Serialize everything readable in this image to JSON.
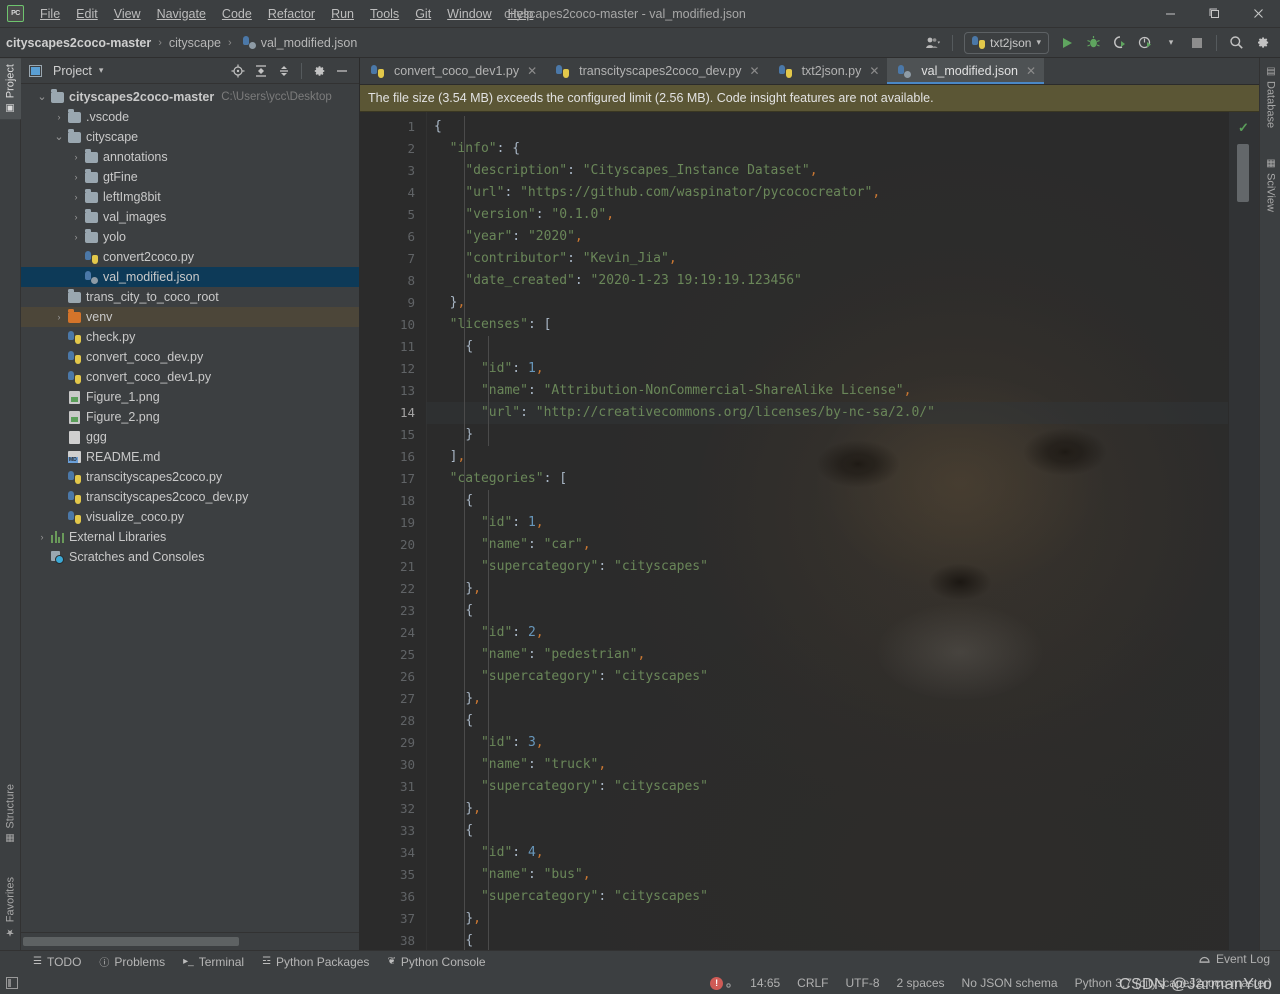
{
  "window": {
    "title": "cityscapes2coco-master - val_modified.json",
    "minimize": "–",
    "maximize": "❐",
    "close": "✕"
  },
  "menubar": {
    "items": [
      "File",
      "Edit",
      "View",
      "Navigate",
      "Code",
      "Refactor",
      "Run",
      "Tools",
      "Git",
      "Window",
      "Help"
    ]
  },
  "breadcrumb": {
    "items": [
      "cityscapes2coco-master",
      "cityscape",
      "val_modified.json"
    ],
    "separator": "›"
  },
  "toolbar": {
    "run_config": "txt2json",
    "dropdown_caret": "▾",
    "run_tooltip": "Run",
    "debug_tooltip": "Debug",
    "coverage_tooltip": "Run with Coverage",
    "profile_tooltip": "Profile",
    "stop_tooltip": "Stop",
    "search_tooltip": "Search Everywhere",
    "settings_tooltip": "Settings"
  },
  "left_stripe": {
    "project": "Project",
    "structure": "Structure",
    "favorites": "Favorites"
  },
  "right_stripe": {
    "database": "Database",
    "sciview": "SciView"
  },
  "project_panel": {
    "title": "Project",
    "title_caret": "▾",
    "icons": [
      "locate-icon",
      "expand-all-icon",
      "collapse-all-icon",
      "settings-icon",
      "hide-icon"
    ],
    "tree": [
      {
        "label": "cityscapes2coco-master",
        "hint": "C:\\Users\\ycc\\Desktop",
        "indent": 0,
        "arrow": "⌄",
        "icon": "folder",
        "bold": true,
        "state": "normal"
      },
      {
        "label": ".vscode",
        "hint": "",
        "indent": 1,
        "arrow": "›",
        "icon": "folder",
        "bold": false,
        "state": "normal"
      },
      {
        "label": "cityscape",
        "hint": "",
        "indent": 1,
        "arrow": "⌄",
        "icon": "folder",
        "bold": false,
        "state": "normal"
      },
      {
        "label": "annotations",
        "hint": "",
        "indent": 2,
        "arrow": "›",
        "icon": "folder",
        "bold": false,
        "state": "normal"
      },
      {
        "label": "gtFine",
        "hint": "",
        "indent": 2,
        "arrow": "›",
        "icon": "folder",
        "bold": false,
        "state": "normal"
      },
      {
        "label": "leftImg8bit",
        "hint": "",
        "indent": 2,
        "arrow": "›",
        "icon": "folder",
        "bold": false,
        "state": "normal"
      },
      {
        "label": "val_images",
        "hint": "",
        "indent": 2,
        "arrow": "›",
        "icon": "folder",
        "bold": false,
        "state": "normal"
      },
      {
        "label": "yolo",
        "hint": "",
        "indent": 2,
        "arrow": "›",
        "icon": "folder",
        "bold": false,
        "state": "normal"
      },
      {
        "label": "convert2coco.py",
        "hint": "",
        "indent": 2,
        "arrow": "",
        "icon": "python",
        "bold": false,
        "state": "normal"
      },
      {
        "label": "val_modified.json",
        "hint": "",
        "indent": 2,
        "arrow": "",
        "icon": "json",
        "bold": false,
        "state": "selected"
      },
      {
        "label": "trans_city_to_coco_root",
        "hint": "",
        "indent": 1,
        "arrow": "",
        "icon": "folder",
        "bold": false,
        "state": "normal"
      },
      {
        "label": "venv",
        "hint": "",
        "indent": 1,
        "arrow": "›",
        "icon": "folder-orange",
        "bold": false,
        "state": "venv"
      },
      {
        "label": "check.py",
        "hint": "",
        "indent": 1,
        "arrow": "",
        "icon": "python",
        "bold": false,
        "state": "normal"
      },
      {
        "label": "convert_coco_dev.py",
        "hint": "",
        "indent": 1,
        "arrow": "",
        "icon": "python",
        "bold": false,
        "state": "normal"
      },
      {
        "label": "convert_coco_dev1.py",
        "hint": "",
        "indent": 1,
        "arrow": "",
        "icon": "python",
        "bold": false,
        "state": "normal"
      },
      {
        "label": "Figure_1.png",
        "hint": "",
        "indent": 1,
        "arrow": "",
        "icon": "png",
        "bold": false,
        "state": "normal"
      },
      {
        "label": "Figure_2.png",
        "hint": "",
        "indent": 1,
        "arrow": "",
        "icon": "png",
        "bold": false,
        "state": "normal"
      },
      {
        "label": "ggg",
        "hint": "",
        "indent": 1,
        "arrow": "",
        "icon": "file",
        "bold": false,
        "state": "normal"
      },
      {
        "label": "README.md",
        "hint": "",
        "indent": 1,
        "arrow": "",
        "icon": "md",
        "bold": false,
        "state": "normal"
      },
      {
        "label": "transcityscapes2coco.py",
        "hint": "",
        "indent": 1,
        "arrow": "",
        "icon": "python",
        "bold": false,
        "state": "normal"
      },
      {
        "label": "transcityscapes2coco_dev.py",
        "hint": "",
        "indent": 1,
        "arrow": "",
        "icon": "python",
        "bold": false,
        "state": "normal"
      },
      {
        "label": "visualize_coco.py",
        "hint": "",
        "indent": 1,
        "arrow": "",
        "icon": "python",
        "bold": false,
        "state": "normal"
      },
      {
        "label": "External Libraries",
        "hint": "",
        "indent": 0,
        "arrow": "›",
        "icon": "lib",
        "bold": false,
        "state": "normal"
      },
      {
        "label": "Scratches and Consoles",
        "hint": "",
        "indent": 0,
        "arrow": "",
        "icon": "scratch",
        "bold": false,
        "state": "normal"
      }
    ]
  },
  "editor": {
    "tabs": [
      {
        "label": "convert_coco_dev1.py",
        "icon": "python",
        "active": false,
        "close": "✕"
      },
      {
        "label": "transcityscapes2coco_dev.py",
        "icon": "python",
        "active": false,
        "close": "✕"
      },
      {
        "label": "txt2json.py",
        "icon": "python",
        "active": false,
        "close": "✕"
      },
      {
        "label": "val_modified.json",
        "icon": "json",
        "active": true,
        "close": "✕"
      }
    ],
    "warning": "The file size (3.54 MB) exceeds the configured limit (2.56 MB). Code insight features are not available.",
    "inspection_status": "✓",
    "current_line": 14,
    "lines": [
      {
        "n": 1,
        "text": "{"
      },
      {
        "n": 2,
        "text": "  \"info\": {"
      },
      {
        "n": 3,
        "text": "    \"description\": \"Cityscapes_Instance Dataset\","
      },
      {
        "n": 4,
        "text": "    \"url\": \"https://github.com/waspinator/pycococreator\","
      },
      {
        "n": 5,
        "text": "    \"version\": \"0.1.0\","
      },
      {
        "n": 6,
        "text": "    \"year\": \"2020\","
      },
      {
        "n": 7,
        "text": "    \"contributor\": \"Kevin_Jia\","
      },
      {
        "n": 8,
        "text": "    \"date_created\": \"2020-1-23 19:19:19.123456\""
      },
      {
        "n": 9,
        "text": "  },"
      },
      {
        "n": 10,
        "text": "  \"licenses\": ["
      },
      {
        "n": 11,
        "text": "    {"
      },
      {
        "n": 12,
        "text": "      \"id\": 1,"
      },
      {
        "n": 13,
        "text": "      \"name\": \"Attribution-NonCommercial-ShareAlike License\","
      },
      {
        "n": 14,
        "text": "      \"url\": \"http://creativecommons.org/licenses/by-nc-sa/2.0/\""
      },
      {
        "n": 15,
        "text": "    }"
      },
      {
        "n": 16,
        "text": "  ],"
      },
      {
        "n": 17,
        "text": "  \"categories\": ["
      },
      {
        "n": 18,
        "text": "    {"
      },
      {
        "n": 19,
        "text": "      \"id\": 1,"
      },
      {
        "n": 20,
        "text": "      \"name\": \"car\","
      },
      {
        "n": 21,
        "text": "      \"supercategory\": \"cityscapes\""
      },
      {
        "n": 22,
        "text": "    },"
      },
      {
        "n": 23,
        "text": "    {"
      },
      {
        "n": 24,
        "text": "      \"id\": 2,"
      },
      {
        "n": 25,
        "text": "      \"name\": \"pedestrian\","
      },
      {
        "n": 26,
        "text": "      \"supercategory\": \"cityscapes\""
      },
      {
        "n": 27,
        "text": "    },"
      },
      {
        "n": 28,
        "text": "    {"
      },
      {
        "n": 29,
        "text": "      \"id\": 3,"
      },
      {
        "n": 30,
        "text": "      \"name\": \"truck\","
      },
      {
        "n": 31,
        "text": "      \"supercategory\": \"cityscapes\""
      },
      {
        "n": 32,
        "text": "    },"
      },
      {
        "n": 33,
        "text": "    {"
      },
      {
        "n": 34,
        "text": "      \"id\": 4,"
      },
      {
        "n": 35,
        "text": "      \"name\": \"bus\","
      },
      {
        "n": 36,
        "text": "      \"supercategory\": \"cityscapes\""
      },
      {
        "n": 37,
        "text": "    },"
      },
      {
        "n": 38,
        "text": "    {"
      }
    ]
  },
  "bottom_tools": [
    {
      "label": "TODO",
      "icon": "todo-icon"
    },
    {
      "label": "Problems",
      "icon": "problems-icon"
    },
    {
      "label": "Terminal",
      "icon": "terminal-icon"
    },
    {
      "label": "Python Packages",
      "icon": "packages-icon"
    },
    {
      "label": "Python Console",
      "icon": "python-console-icon"
    }
  ],
  "statusbar": {
    "event_log": "Event Log",
    "caret_position": "14:65",
    "line_separator": "CRLF",
    "encoding": "UTF-8",
    "indent": "2 spaces",
    "schema": "No JSON schema",
    "interpreter": "Python 3.7 (cityscapes2coco-master)",
    "watermark": "CSDN @JarmanYuo"
  },
  "colors": {
    "accent": "#4a88c7",
    "selection": "#0d3a58",
    "warning_bg": "#5b5635",
    "editor_bg": "#2b2b2b",
    "panel_bg": "#3c3f41",
    "string": "#6a8759",
    "number": "#6897bb",
    "punctuation": "#cc7832"
  }
}
